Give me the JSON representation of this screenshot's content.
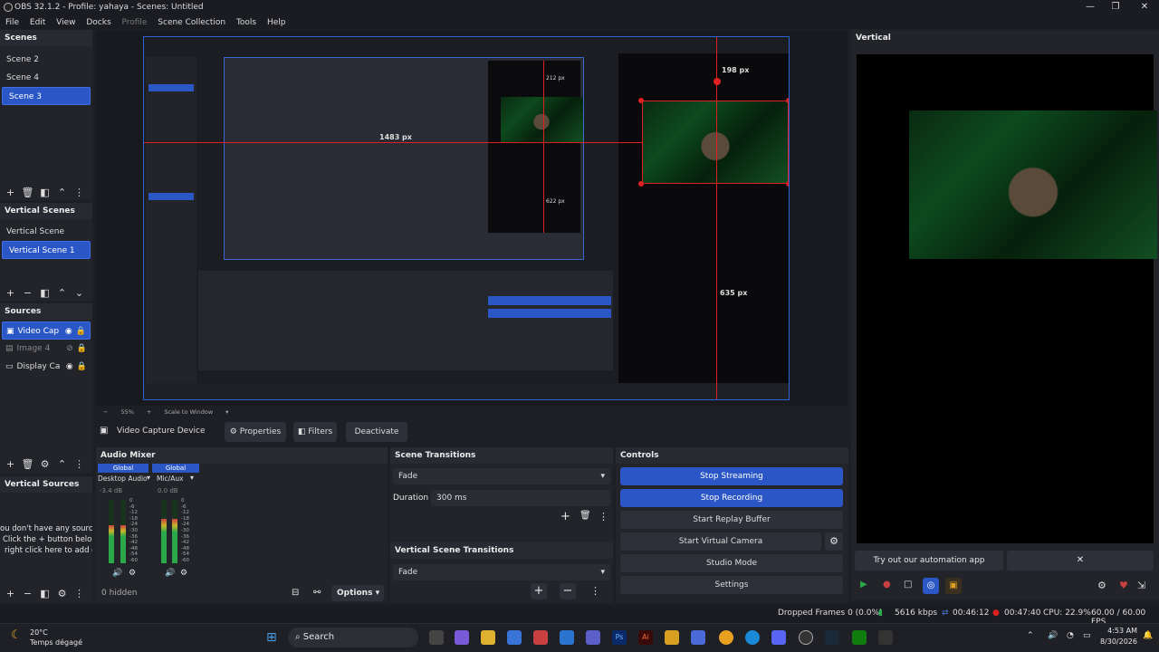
{
  "window": {
    "title": "OBS 32.1.2 - Profile: yahaya - Scenes: Untitled",
    "controls": [
      "—",
      "❐",
      "✕"
    ]
  },
  "menu": [
    "File",
    "Edit",
    "View",
    "Docks",
    "Profile",
    "Scene Collection",
    "Tools",
    "Help"
  ],
  "scenes": {
    "title": "Scenes",
    "items": [
      "Scene 2",
      "Scene 4",
      "Scene 3"
    ],
    "selected_index": 2
  },
  "vertical_scenes": {
    "title": "Vertical Scenes",
    "items": [
      "Vertical Scene",
      "Vertical Scene 1"
    ],
    "selected_index": 1
  },
  "sources": {
    "title": "Sources",
    "items": [
      {
        "label": "Video Cap",
        "icon": "camera-icon",
        "visible": true,
        "locked": true,
        "selected": true
      },
      {
        "label": "Image 4",
        "icon": "image-icon",
        "visible": false,
        "locked": true,
        "selected": false
      },
      {
        "label": "Display Ca",
        "icon": "display-icon",
        "visible": true,
        "locked": true,
        "selected": false
      }
    ]
  },
  "vertical_sources": {
    "title": "Vertical Sources",
    "empty_lines": [
      "ou don't have any source",
      "Click the + button below",
      "right click here to add or"
    ]
  },
  "preview": {
    "zoom": "55%",
    "scale_label": "Scale to Window",
    "measure_labels": {
      "top_inner": "198 px",
      "bottom_inner": "635 px",
      "nested_left": "1483 px",
      "nested_small": "212 px",
      "nested_mid": "622 px"
    }
  },
  "vertical_panel": {
    "title": "Vertical",
    "automation_text": "Try out our automation app",
    "close": "✕"
  },
  "source_toolbar": {
    "name": "Video Capture Device",
    "properties": "Properties",
    "filters": "Filters",
    "deactivate": "Deactivate"
  },
  "audio_mixer": {
    "title": "Audio Mixer",
    "channels": [
      {
        "global": "Global",
        "name": "Desktop Audio",
        "db": "-3.4 dB",
        "level": 0.6
      },
      {
        "global": "Global",
        "name": "Mic/Aux",
        "db": "0.0 dB",
        "level": 0.7
      }
    ],
    "scale": [
      "0",
      "-6",
      "-12",
      "-18",
      "-24",
      "-30",
      "-36",
      "-42",
      "-48",
      "-54",
      "-60"
    ],
    "hidden": "0 hidden",
    "options": "Options"
  },
  "scene_transitions": {
    "title": "Scene Transitions",
    "transition": "Fade",
    "duration_label": "Duration",
    "duration_value": "300 ms"
  },
  "vertical_scene_transitions": {
    "title": "Vertical Scene Transitions",
    "transition": "Fade"
  },
  "controls": {
    "title": "Controls",
    "buttons": [
      "Stop Streaming",
      "Stop Recording",
      "Start Replay Buffer",
      "Start Virtual Camera",
      "Studio Mode",
      "Settings"
    ]
  },
  "status": {
    "dropped": "Dropped Frames 0 (0.0%)",
    "kbps": "5616 kbps",
    "stream_time": "00:46:12",
    "rec_time": "00:47:40",
    "cpu": "CPU: 22.9%",
    "fps": "60.00 / 60.00 FPS"
  },
  "taskbar": {
    "weather_temp": "20°C",
    "weather_text": "Temps dégagé",
    "search": "Search",
    "time": "4:53 AM",
    "date": "8/30/2026"
  },
  "colors": {
    "accent": "#2a56c6",
    "red_guide": "#e02020",
    "preview_border": "#2b63d8"
  }
}
